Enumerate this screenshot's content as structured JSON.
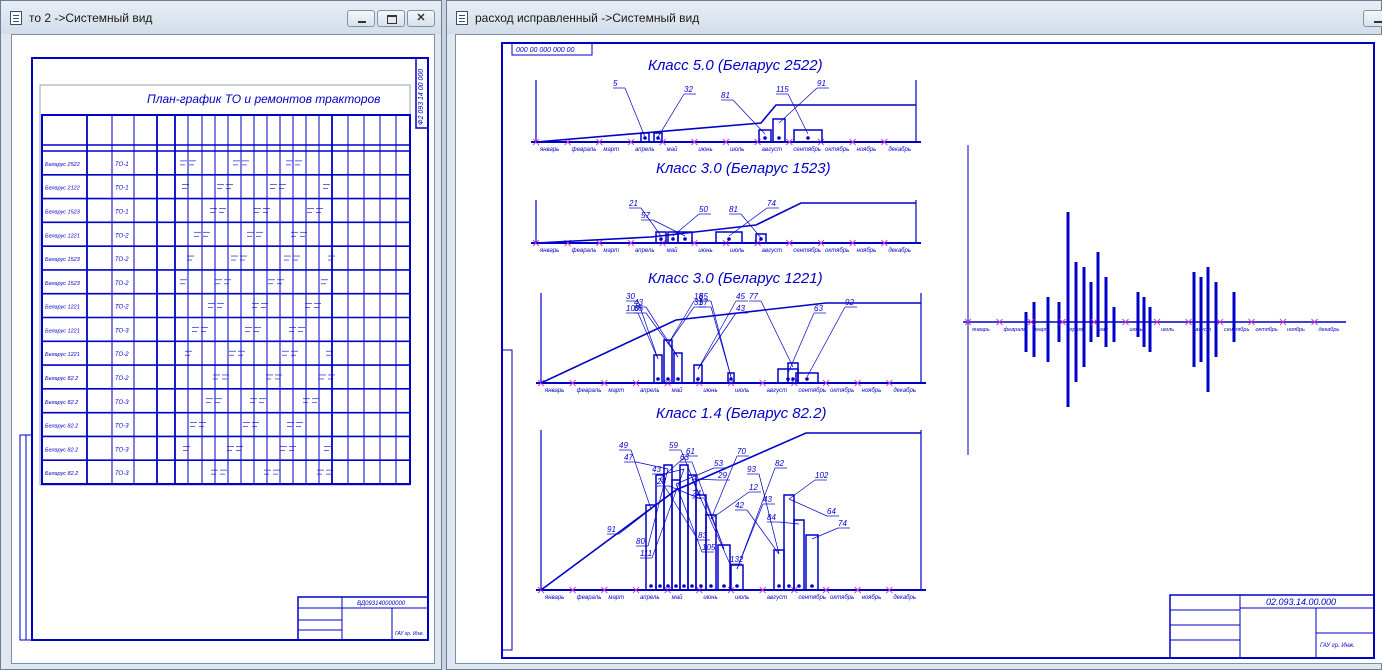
{
  "windows": [
    {
      "title": "то 2 ->Системный вид"
    },
    {
      "title": "расход исправленный ->Системный вид"
    }
  ],
  "controls": {
    "minimize": "",
    "maximize": "",
    "close": "✕"
  },
  "left_sheet": {
    "header": "Ф2 093 14 00 000",
    "title": "План-график ТО и ремонтов тракторов",
    "rows": [
      "Беларус 2522",
      "Беларус 2122",
      "Беларус 1523",
      "Беларус 1221",
      "Беларус 1523",
      "Беларус 1523",
      "Беларус 1221",
      "Беларус 1221",
      "Беларус 1221",
      "Беларус 82.2",
      "Беларус 82.2",
      "Беларус 82.2",
      "Беларус 82.2",
      "Беларус 82.2"
    ],
    "to_labels": [
      "ТО-1",
      "ТО-1",
      "ТО-1",
      "ТО-2",
      "ТО-2",
      "ТО-2",
      "ТО-2",
      "ТО-3",
      "ТО-2",
      "ТО-2",
      "ТО-3",
      "ТО-3",
      "ТО-3",
      "ТО-3"
    ],
    "stamp_code": "ВД093140000000",
    "stamp_sheet": "ГАУ гр. Инж."
  },
  "right_sheet": {
    "corner_code": "000 00 000 000 00",
    "charts": [
      {
        "title": "Класс 5.0 (Беларус 2522)",
        "labels": [
          "5",
          "32",
          "81",
          "91",
          "115"
        ]
      },
      {
        "title": "Класс 3.0 (Беларус 1523)",
        "labels": [
          "21",
          "50",
          "57",
          "74",
          "81"
        ]
      },
      {
        "title": "Класс 3.0 (Беларус 1221)",
        "labels": [
          "30",
          "31",
          "35",
          "45",
          "57",
          "63",
          "77",
          "92",
          "100",
          "18",
          "43",
          "43",
          "65"
        ]
      },
      {
        "title": "Класс 1.4 (Беларус 82.2)",
        "labels": [
          "49",
          "61",
          "47",
          "53",
          "43",
          "29",
          "28",
          "12",
          "24",
          "43",
          "42",
          "64",
          "84",
          "74",
          "91",
          "83",
          "80",
          "105",
          "111",
          "132",
          "59",
          "70",
          "63",
          "82",
          "93",
          "102"
        ]
      }
    ],
    "months": [
      "январь",
      "февраль",
      "март",
      "апрель",
      "май",
      "июнь",
      "июль",
      "август",
      "сентябрь",
      "октябрь",
      "ноябрь",
      "декабрь"
    ],
    "stamp_code": "02.093.14.00.000",
    "stamp_sheet": "ГАУ гр. Инж."
  }
}
